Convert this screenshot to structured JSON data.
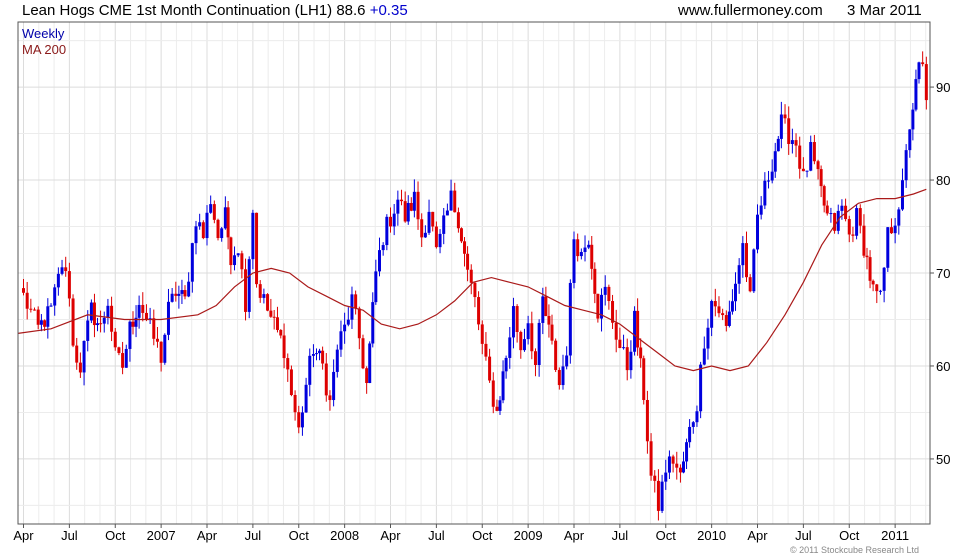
{
  "header": {
    "title": "Lean Hogs CME 1st Month Continuation (LH1) 88.6",
    "change": "+0.35",
    "site": "www.fullermoney.com",
    "date": "3 Mar 2011"
  },
  "footer": {
    "copyright": "© 2011 Stockcube Research Ltd"
  },
  "colors": {
    "up": "#0000dd",
    "down": "#dd0000",
    "ma": "#aa1a1a",
    "grid": "#dcdcdc",
    "frame": "#555555"
  },
  "chart_data": {
    "type": "candlestick",
    "legend": [
      "Weekly",
      "MA 200"
    ],
    "x_ticks": [
      "Apr",
      "Jul",
      "Oct",
      "2007",
      "Apr",
      "Jul",
      "Oct",
      "2008",
      "Apr",
      "Jul",
      "Oct",
      "2009",
      "Apr",
      "Jul",
      "Oct",
      "2010",
      "Apr",
      "Jul",
      "Oct",
      "2011"
    ],
    "y_ticks": [
      50,
      60,
      70,
      80,
      90
    ],
    "ylim": [
      43,
      97
    ],
    "xlim": [
      2006.22,
      2011.19
    ],
    "grid": true,
    "series": [
      {
        "name": "Weekly",
        "kind": "weekly-close",
        "points": [
          [
            2006.25,
            67.5
          ],
          [
            2006.33,
            64
          ],
          [
            2006.4,
            66
          ],
          [
            2006.46,
            71
          ],
          [
            2006.5,
            68
          ],
          [
            2006.52,
            62
          ],
          [
            2006.56,
            60
          ],
          [
            2006.62,
            66
          ],
          [
            2006.67,
            64
          ],
          [
            2006.71,
            67
          ],
          [
            2006.75,
            61
          ],
          [
            2006.79,
            60
          ],
          [
            2006.83,
            64
          ],
          [
            2006.88,
            67
          ],
          [
            2006.92,
            65
          ],
          [
            2006.96,
            63
          ],
          [
            2007.0,
            61
          ],
          [
            2007.04,
            66
          ],
          [
            2007.08,
            68
          ],
          [
            2007.13,
            67
          ],
          [
            2007.19,
            76
          ],
          [
            2007.23,
            74
          ],
          [
            2007.27,
            78
          ],
          [
            2007.31,
            74
          ],
          [
            2007.35,
            76
          ],
          [
            2007.38,
            72
          ],
          [
            2007.42,
            73
          ],
          [
            2007.46,
            67
          ],
          [
            2007.5,
            77
          ],
          [
            2007.52,
            69
          ],
          [
            2007.58,
            66
          ],
          [
            2007.67,
            62
          ],
          [
            2007.71,
            57
          ],
          [
            2007.75,
            53
          ],
          [
            2007.79,
            58
          ],
          [
            2007.83,
            62
          ],
          [
            2007.88,
            60
          ],
          [
            2007.92,
            56
          ],
          [
            2007.96,
            62
          ],
          [
            2008.0,
            64
          ],
          [
            2008.04,
            67
          ],
          [
            2008.08,
            63
          ],
          [
            2008.12,
            58
          ],
          [
            2008.17,
            70
          ],
          [
            2008.21,
            74
          ],
          [
            2008.29,
            78
          ],
          [
            2008.33,
            76
          ],
          [
            2008.38,
            78
          ],
          [
            2008.42,
            74
          ],
          [
            2008.46,
            77
          ],
          [
            2008.5,
            72
          ],
          [
            2008.54,
            75
          ],
          [
            2008.58,
            78
          ],
          [
            2008.62,
            76
          ],
          [
            2008.67,
            70
          ],
          [
            2008.71,
            67
          ],
          [
            2008.75,
            62
          ],
          [
            2008.79,
            58
          ],
          [
            2008.83,
            55
          ],
          [
            2008.88,
            61
          ],
          [
            2008.92,
            66
          ],
          [
            2008.96,
            62
          ],
          [
            2009.0,
            65
          ],
          [
            2009.04,
            60
          ],
          [
            2009.08,
            67
          ],
          [
            2009.13,
            62
          ],
          [
            2009.17,
            58
          ],
          [
            2009.21,
            62
          ],
          [
            2009.25,
            74
          ],
          [
            2009.29,
            72
          ],
          [
            2009.33,
            74
          ],
          [
            2009.38,
            66
          ],
          [
            2009.42,
            68
          ],
          [
            2009.5,
            62
          ],
          [
            2009.54,
            60
          ],
          [
            2009.58,
            65
          ],
          [
            2009.63,
            57
          ],
          [
            2009.67,
            48
          ],
          [
            2009.71,
            45
          ],
          [
            2009.75,
            49
          ],
          [
            2009.79,
            50
          ],
          [
            2009.83,
            48
          ],
          [
            2009.88,
            53
          ],
          [
            2009.92,
            56
          ],
          [
            2009.96,
            63
          ],
          [
            2010.0,
            67
          ],
          [
            2010.04,
            66
          ],
          [
            2010.08,
            64
          ],
          [
            2010.13,
            69
          ],
          [
            2010.17,
            73
          ],
          [
            2010.21,
            67
          ],
          [
            2010.25,
            76
          ],
          [
            2010.29,
            79
          ],
          [
            2010.33,
            82
          ],
          [
            2010.38,
            86
          ],
          [
            2010.42,
            85
          ],
          [
            2010.46,
            84
          ],
          [
            2010.5,
            80
          ],
          [
            2010.54,
            83
          ],
          [
            2010.58,
            80
          ],
          [
            2010.63,
            76
          ],
          [
            2010.67,
            75
          ],
          [
            2010.71,
            77
          ],
          [
            2010.75,
            74
          ],
          [
            2010.79,
            76
          ],
          [
            2010.83,
            73
          ],
          [
            2010.88,
            68
          ],
          [
            2010.92,
            67
          ],
          [
            2010.96,
            74
          ],
          [
            2011.0,
            76
          ],
          [
            2011.04,
            79
          ],
          [
            2011.08,
            86
          ],
          [
            2011.13,
            92
          ],
          [
            2011.15,
            92
          ],
          [
            2011.17,
            88.6
          ]
        ]
      },
      {
        "name": "MA 200",
        "kind": "line",
        "points": [
          [
            2006.22,
            63.5
          ],
          [
            2006.4,
            64.0
          ],
          [
            2006.6,
            65.5
          ],
          [
            2006.8,
            65.0
          ],
          [
            2007.0,
            65.0
          ],
          [
            2007.2,
            65.5
          ],
          [
            2007.3,
            66.5
          ],
          [
            2007.4,
            68.5
          ],
          [
            2007.5,
            70.0
          ],
          [
            2007.6,
            70.5
          ],
          [
            2007.7,
            70.0
          ],
          [
            2007.8,
            68.5
          ],
          [
            2007.9,
            67.5
          ],
          [
            2008.0,
            66.5
          ],
          [
            2008.1,
            66.0
          ],
          [
            2008.2,
            64.5
          ],
          [
            2008.3,
            64.0
          ],
          [
            2008.4,
            64.5
          ],
          [
            2008.5,
            65.5
          ],
          [
            2008.6,
            67.0
          ],
          [
            2008.7,
            69.0
          ],
          [
            2008.8,
            69.5
          ],
          [
            2008.9,
            69.0
          ],
          [
            2009.0,
            68.5
          ],
          [
            2009.1,
            67.5
          ],
          [
            2009.2,
            66.5
          ],
          [
            2009.3,
            66.0
          ],
          [
            2009.4,
            65.5
          ],
          [
            2009.5,
            64.5
          ],
          [
            2009.6,
            63.0
          ],
          [
            2009.7,
            61.5
          ],
          [
            2009.8,
            60.0
          ],
          [
            2009.9,
            59.5
          ],
          [
            2010.0,
            60.0
          ],
          [
            2010.1,
            59.5
          ],
          [
            2010.2,
            60.0
          ],
          [
            2010.3,
            62.5
          ],
          [
            2010.4,
            65.5
          ],
          [
            2010.5,
            69.0
          ],
          [
            2010.6,
            73.0
          ],
          [
            2010.7,
            76.0
          ],
          [
            2010.8,
            77.5
          ],
          [
            2010.9,
            78.0
          ],
          [
            2011.0,
            78.0
          ],
          [
            2011.1,
            78.5
          ],
          [
            2011.17,
            79.0
          ]
        ]
      }
    ]
  }
}
